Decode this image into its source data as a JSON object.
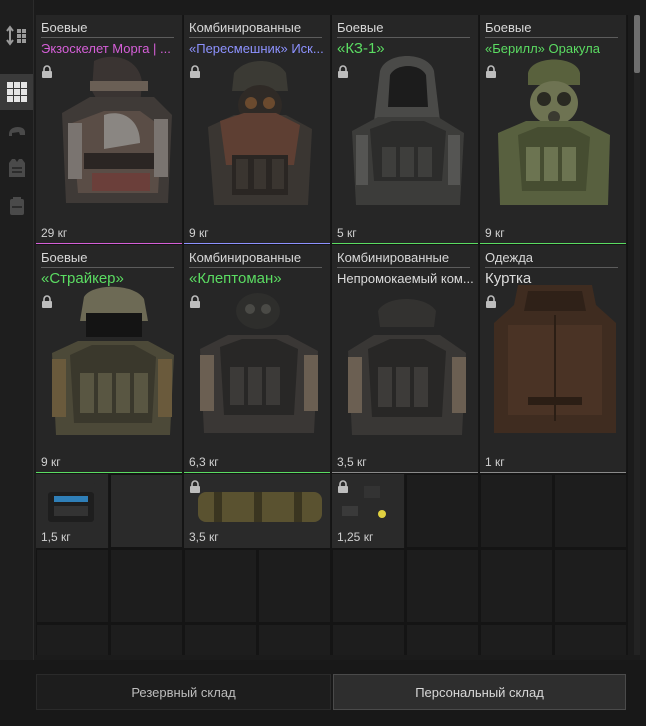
{
  "colors": {
    "legendary": "#d55fd8",
    "epic": "#8d92ff",
    "rare": "#5bdc62",
    "common": "#dcdcdc"
  },
  "sidebar": {
    "items": [
      {
        "icon": "sort-icon",
        "active": false
      },
      {
        "icon": "grid-view-icon",
        "active": true
      },
      {
        "icon": "helmet-icon",
        "active": false
      },
      {
        "icon": "armor-icon",
        "active": false
      },
      {
        "icon": "backpack-icon",
        "active": false
      }
    ]
  },
  "items": [
    {
      "category": "Боевые",
      "title": "Экзоскелет Морга | ...",
      "rarity": "legendary",
      "weight": "29 кг"
    },
    {
      "category": "Комбинированные",
      "title": "«Пересмешник» Иск...",
      "rarity": "epic",
      "weight": "9 кг"
    },
    {
      "category": "Боевые",
      "title": "«КЗ-1»",
      "rarity": "rare",
      "weight": "5 кг"
    },
    {
      "category": "Боевые",
      "title": "«Берилл» Оракула",
      "rarity": "rare",
      "weight": "9 кг"
    },
    {
      "category": "Боевые",
      "title": "«Страйкер»",
      "rarity": "rare",
      "weight": "9 кг"
    },
    {
      "category": "Комбинированные",
      "title": "«Клептоман»",
      "rarity": "rare",
      "weight": "6,3 кг"
    },
    {
      "category": "Комбинированные",
      "title": "Непромокаемый ком...",
      "rarity": "common",
      "weight": "3,5 кг"
    },
    {
      "category": "Одежда",
      "title": "Куртка",
      "rarity": "common",
      "weight": "1 кг"
    }
  ],
  "small_items": [
    {
      "name": "battery-container",
      "weight": "1,5 кг",
      "locked": false
    },
    {
      "name": "cylinder-container",
      "weight": "3,5 кг",
      "locked": true
    },
    {
      "name": "detector-device",
      "weight": "1,25 кг",
      "locked": true
    }
  ],
  "tabs": {
    "reserve": "Резервный склад",
    "personal": "Персональный склад"
  }
}
